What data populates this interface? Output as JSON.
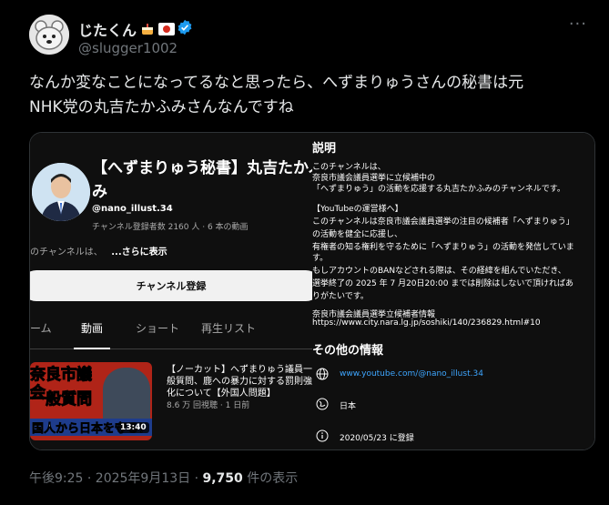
{
  "tweet": {
    "display_name": "じたくん",
    "handle": "@slugger1002",
    "more_label": "···",
    "text_line1": "なんか変なことになってるなと思ったら、へずまりゅうさんの秘書は元",
    "text_line2": "NHK党の丸吉たかふみさんなんですね",
    "time": "午後9:25 · 2025年9月13日 · ",
    "views_count": "9,750",
    "views_label": " 件の表示"
  },
  "channel": {
    "title_line1": "【へずまりゅう秘書】丸吉たかふ",
    "title_line2": "み",
    "handle": "@nano_illust.34",
    "stats": "チャンネル登録者数 2160 人 ‧ 6 本の動画",
    "desc_prefix": "のチャンネルは、",
    "desc_more": "...さらに表示",
    "subscribe_label": "チャンネル登録",
    "tabs": [
      "ーム",
      "動画",
      "ショート",
      "再生リスト"
    ],
    "video": {
      "thumb_line1": "奈良市議会",
      "thumb_line2": "一般質問",
      "thumb_line3": "国人から日本を守る！",
      "duration": "13:40",
      "title": "【ノーカット】へずまりゅう議員一般質問、鹿への暴力に対する罰則強化について【外国人問題】",
      "meta": "8.6 万 回視聴 ‧ 1 日前"
    }
  },
  "about": {
    "heading": "説明",
    "lines": [
      "このチャンネルは、",
      "奈良市議会議員選挙に立候補中の",
      "「へずまりゅう」の活動を応援する丸吉たかふみのチャンネルです。",
      "",
      "【YouTubeの運営様へ】",
      "このチャンネルは奈良市議会議員選挙の注目の候補者「へずまりゅう」",
      "の活動を健全に応援し、",
      "有権者の知る権利を守るために「へずまりゅう」の活動を発信していま",
      "す。",
      "もしアカウントのBANなどされる際は、その経緯を組んでいただき、",
      "選挙終了の 2025 年 7 月20日20:00 までは削除はしないで頂ければあ",
      "りがたいです。",
      "",
      "奈良市議会議員選挙立候補者情報",
      "https://www.city.nara.lg.jp/soshiki/140/236829.html#10"
    ],
    "other_heading": "その他の情報",
    "link": "www.youtube.com/@nano_illust.34",
    "country": "日本",
    "joined": "2020/05/23 に登録"
  },
  "colors": {
    "verified": "#1d9bf0",
    "link": "#3ea6ff"
  }
}
